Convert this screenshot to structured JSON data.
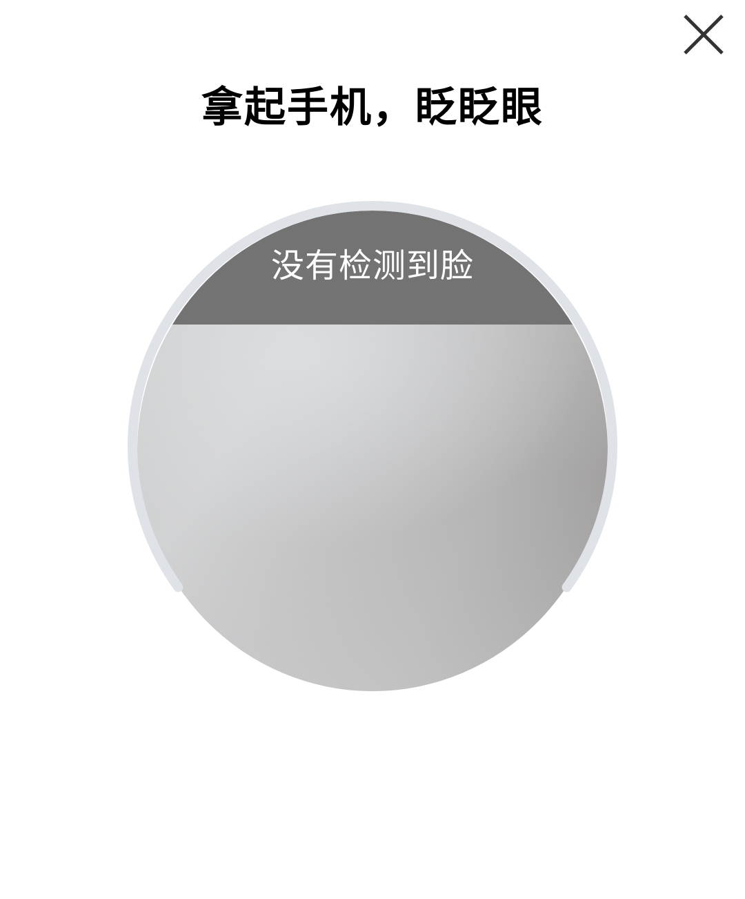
{
  "header": {
    "close_icon": "close-icon"
  },
  "title": "拿起手机，眨眨眼",
  "camera": {
    "status_text": "没有检测到脸",
    "progress_fraction": 0.7
  },
  "colors": {
    "ring": "#dfe3e7",
    "banner": "#737373",
    "title": "#000000"
  }
}
